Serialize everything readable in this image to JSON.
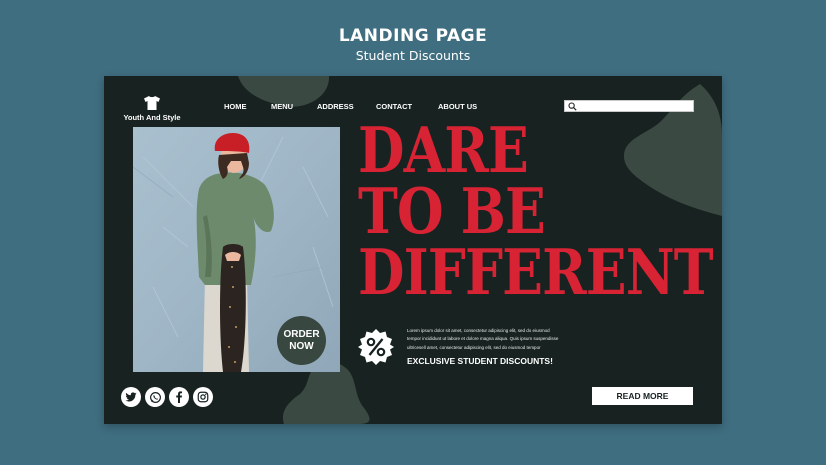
{
  "banner": {
    "title": "LANDING PAGE",
    "subtitle": "Student Discounts"
  },
  "header": {
    "logo_text": "Youth And Style",
    "logo_icon": "tshirt-icon",
    "nav": [
      {
        "label": "HOME"
      },
      {
        "label": "MENU"
      },
      {
        "label": "ADDRESS"
      },
      {
        "label": "CONTACT"
      },
      {
        "label": "ABOUT US"
      }
    ],
    "search": {
      "placeholder": "",
      "icon": "search-icon"
    }
  },
  "hero": {
    "headline": [
      "DARE",
      "TO BE",
      "DIFFERENT"
    ],
    "order_badge": [
      "ORDER",
      "NOW"
    ],
    "lorem_lines": [
      "Lorem ipsum dolor sit amet, consectetur adipiscing elit, sed do eiusmod",
      "tempor incididunt ut labore et dolore magna aliqua. Quis ipsum suspendisse",
      "ultricesell amet, consectetur adipiscing elit, sed do eiusmod tempor"
    ],
    "discount_text": "EXCLUSIVE STUDENT DISCOUNTS!",
    "percent_icon": "percent-badge-icon",
    "read_more": "READ MORE"
  },
  "social": [
    "twitter-icon",
    "whatsapp-icon",
    "facebook-icon",
    "instagram-icon"
  ],
  "colors": {
    "page_background": "#3f6e80",
    "card_background": "#182321",
    "blob": "#3a4a42",
    "headline_red": "#d72334",
    "white": "#ffffff"
  }
}
